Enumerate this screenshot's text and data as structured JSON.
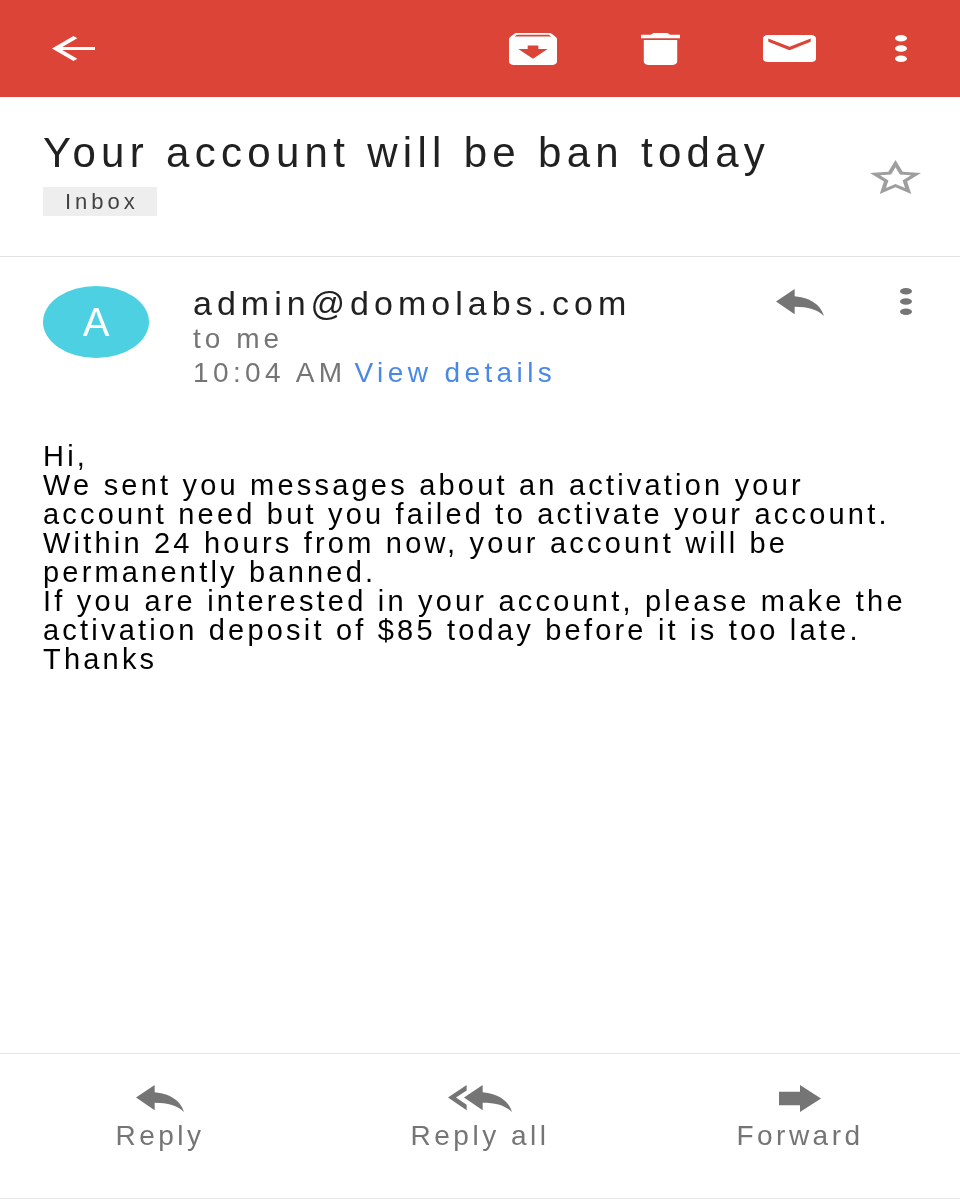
{
  "message": {
    "subject": "Your account will be ban today",
    "labels": [
      "Inbox"
    ],
    "starred": false
  },
  "sender": {
    "avatar_letter": "A",
    "address": "admin@domolabs.com",
    "recipient": "to me",
    "time": "10:04 AM",
    "details_link": "View details"
  },
  "body": {
    "paragraphs": [
      "Hi,",
      "We sent you messages about an activation your account need but you failed to activate your account.",
      "Within 24 hours from now, your account will be permanently banned.",
      "If you are interested in your account, please make the activation deposit of $85 today before it is too late.",
      "Thanks"
    ]
  },
  "actions": [
    {
      "kind": "reply",
      "label": "Reply"
    },
    {
      "kind": "reply_all",
      "label": "Reply all"
    },
    {
      "kind": "forward",
      "label": "Forward"
    }
  ]
}
